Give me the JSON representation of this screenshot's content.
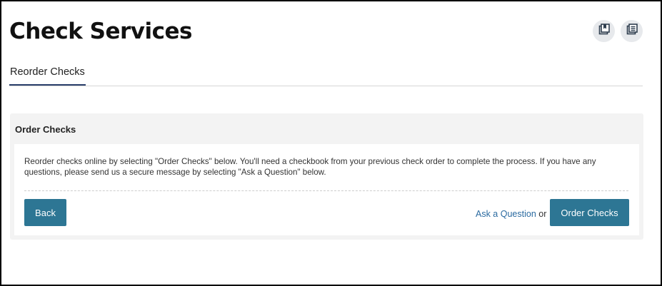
{
  "page": {
    "title": "Check Services"
  },
  "header_icons": [
    {
      "name": "bookmark-icon"
    },
    {
      "name": "document-list-icon"
    }
  ],
  "tabs": [
    {
      "label": "Reorder Checks",
      "active": true
    }
  ],
  "card": {
    "title": "Order Checks",
    "description": "Reorder checks online by selecting \"Order Checks\" below. You'll need a checkbook from your previous check order to complete the process. If you have any questions, please send us a secure message by selecting \"Ask a Question\" below.",
    "back_label": "Back",
    "ask_label": "Ask a Question",
    "or_text": "or",
    "order_label": "Order Checks"
  },
  "colors": {
    "button": "#2d7694",
    "link": "#2a6aa0",
    "tab_underline": "#2a3f6b"
  }
}
